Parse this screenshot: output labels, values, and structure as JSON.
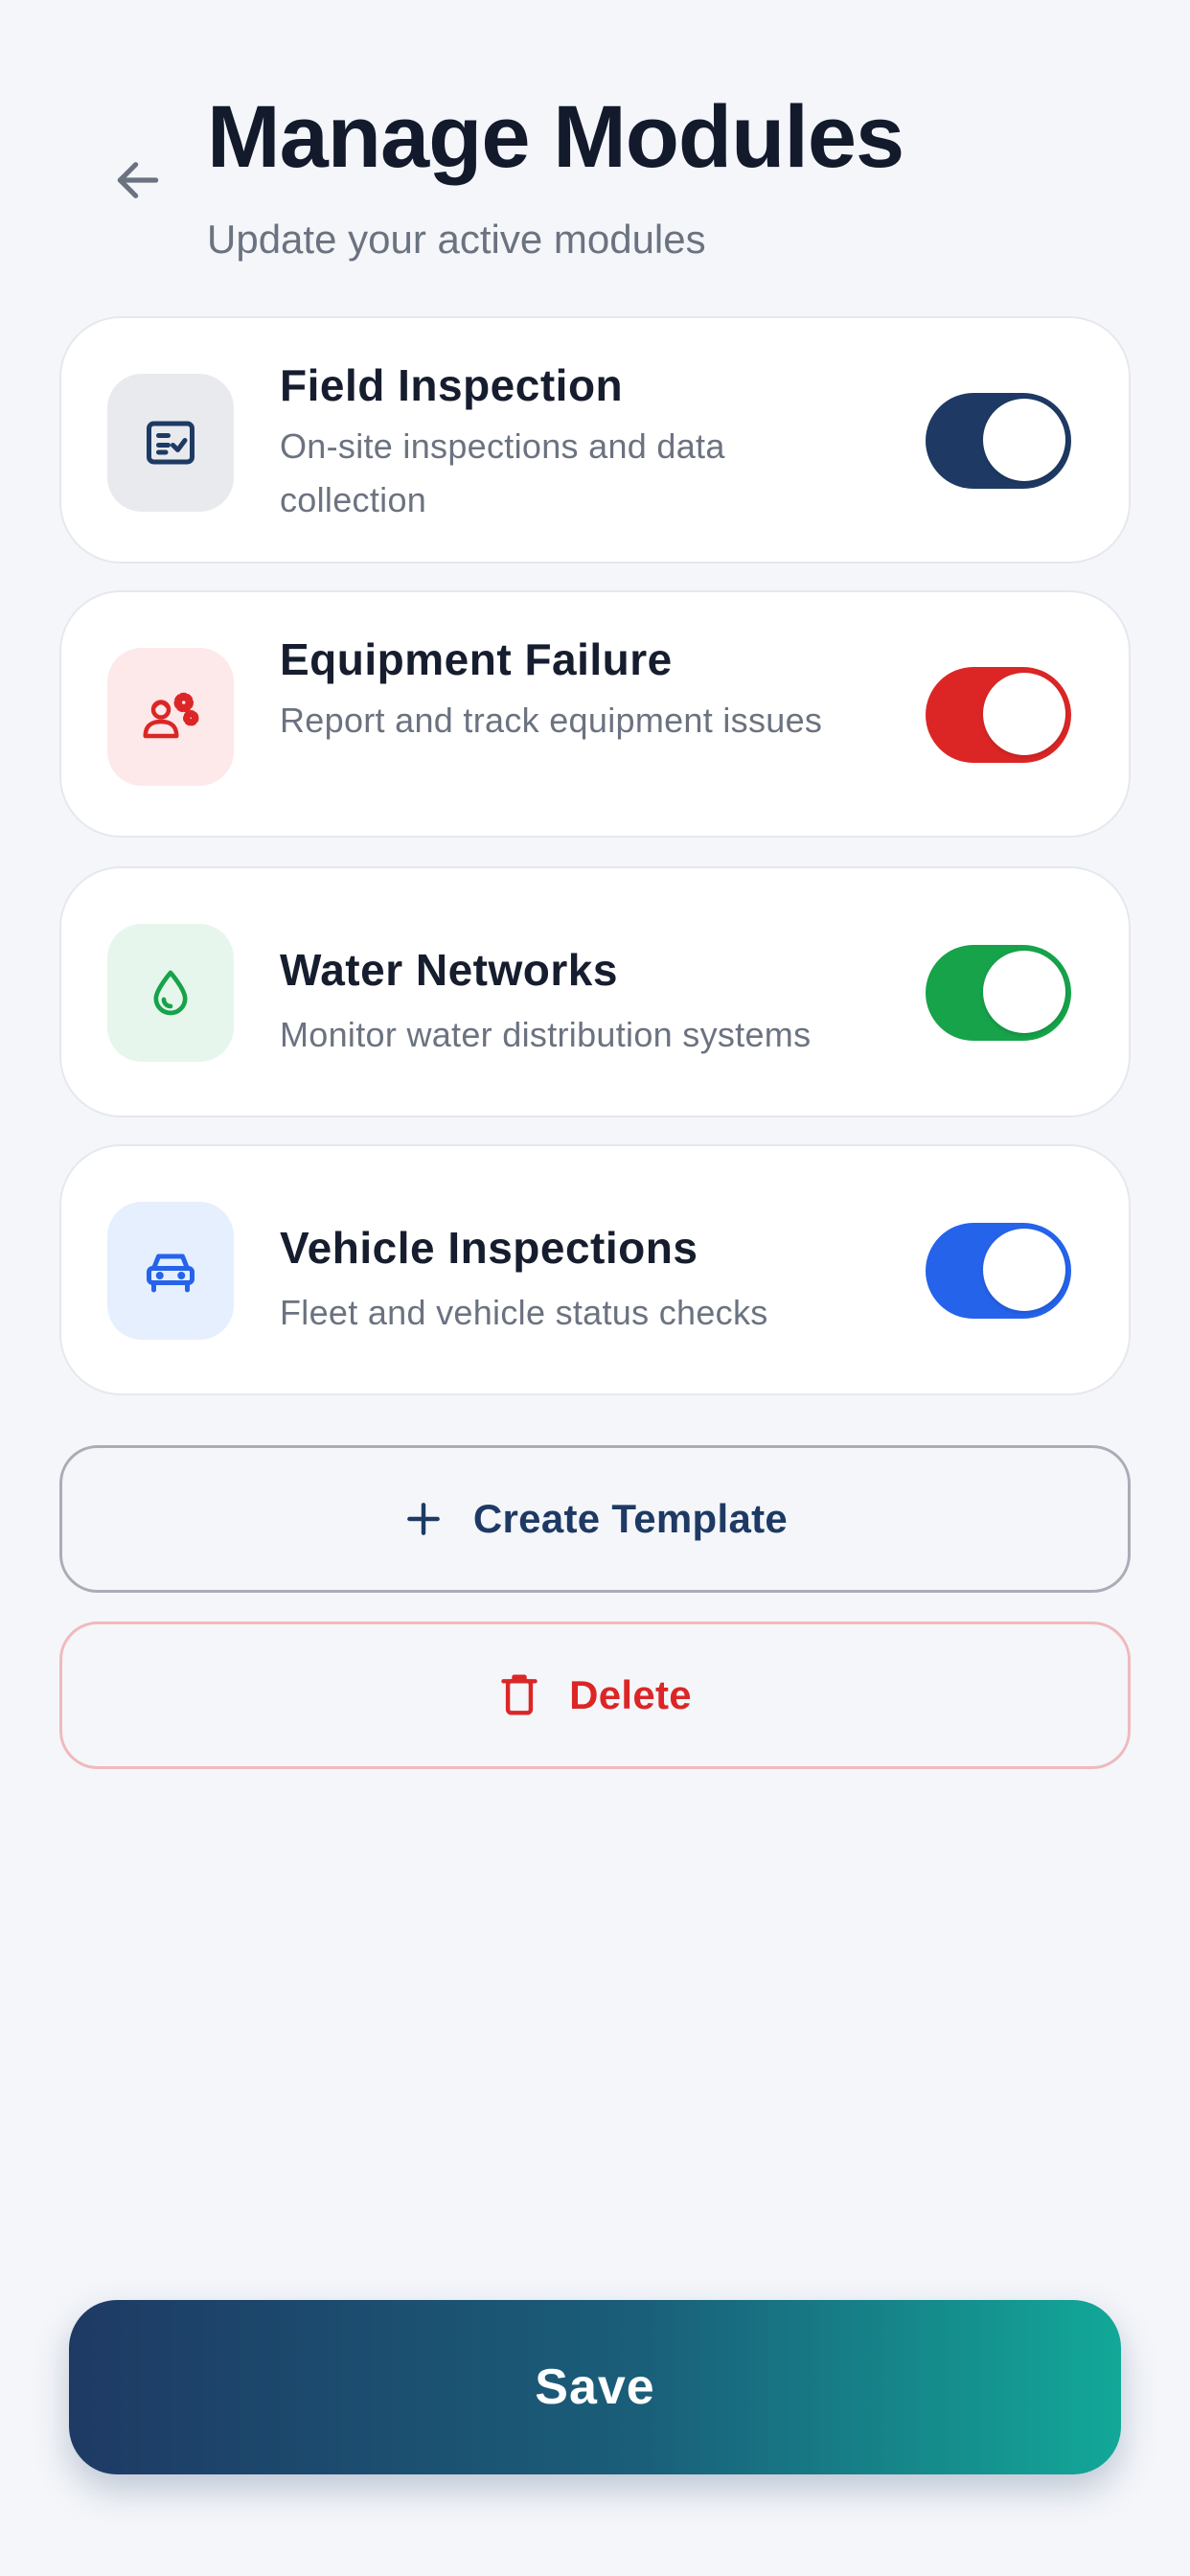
{
  "header": {
    "title": "Manage Modules",
    "subtitle": "Update your active modules",
    "back_icon": "arrow-left-icon"
  },
  "modules": [
    {
      "title": "Field Inspection",
      "description": "On-site inspections and data collection",
      "icon": "checklist-icon",
      "enabled": true,
      "accent_color": "#1e3a64",
      "icon_bg": "#e8eaee"
    },
    {
      "title": "Equipment Failure",
      "description": "Report and track equipment issues",
      "icon": "worker-gears-icon",
      "enabled": true,
      "accent_color": "#dc2626",
      "icon_bg": "#fde8ea"
    },
    {
      "title": "Water Networks",
      "description": "Monitor water distribution systems",
      "icon": "water-drop-icon",
      "enabled": true,
      "accent_color": "#16a34a",
      "icon_bg": "#e6f6ec"
    },
    {
      "title": "Vehicle Inspections",
      "description": "Fleet and vehicle status checks",
      "icon": "car-icon",
      "enabled": true,
      "accent_color": "#2563eb",
      "icon_bg": "#e6effd"
    }
  ],
  "actions": {
    "create_template_label": "Create Template",
    "create_template_color": "#1e3a64",
    "delete_label": "Delete",
    "delete_color": "#dc2626"
  },
  "footer": {
    "save_label": "Save"
  }
}
